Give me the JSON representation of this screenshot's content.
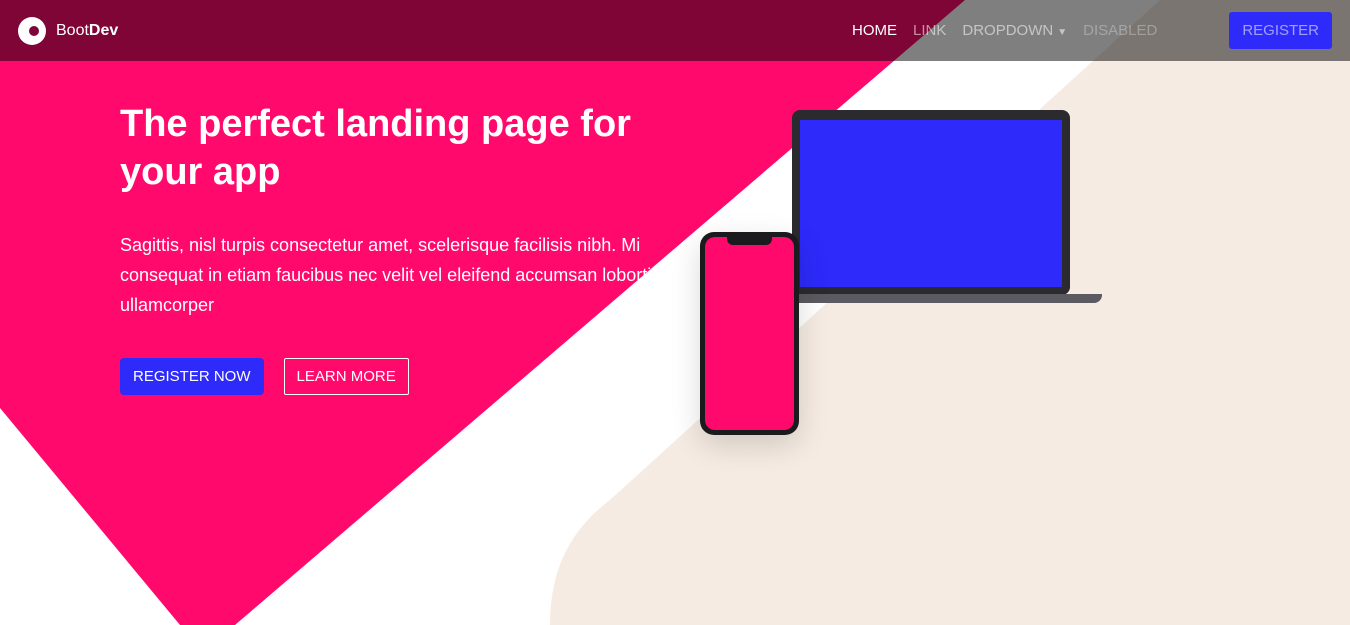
{
  "brand": {
    "prefix": "Boot",
    "suffix": "Dev"
  },
  "nav": {
    "home": "HOME",
    "link": "LINK",
    "dropdown": "DROPDOWN",
    "disabled": "DISABLED",
    "register": "REGISTER"
  },
  "hero": {
    "title": "The perfect landing page for your app",
    "text": "Sagittis, nisl turpis consectetur amet, scelerisque facilisis nibh. Mi consequat in etiam faucibus nec velit vel eleifend accumsan lobortis ullamcorper",
    "primary": "REGISTER NOW",
    "secondary": "LEARN MORE"
  },
  "colors": {
    "pink": "#ff0a6c",
    "blue": "#2d2afa",
    "beige": "#f5ebe2"
  }
}
